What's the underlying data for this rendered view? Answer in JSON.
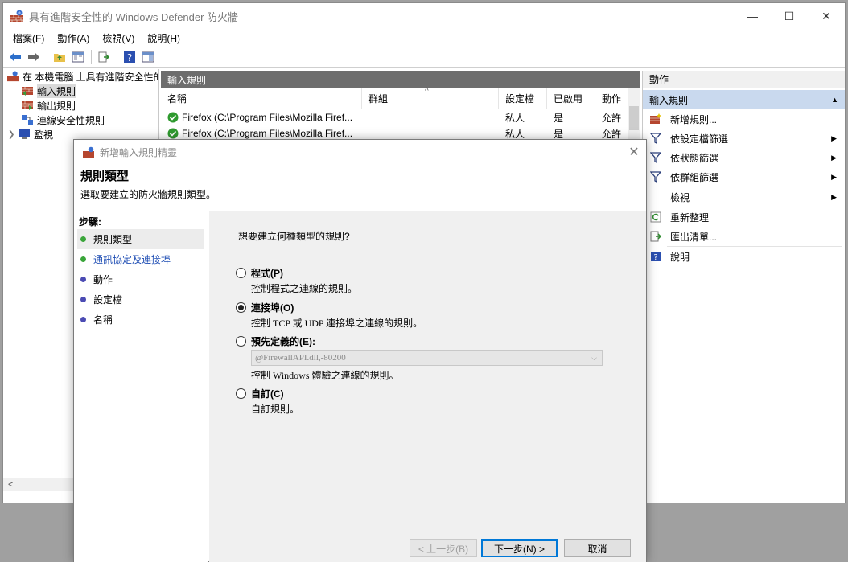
{
  "window": {
    "title": "具有進階安全性的 Windows Defender 防火牆",
    "minimize": "—",
    "maximize": "☐",
    "close": "✕"
  },
  "menu": [
    "檔案(F)",
    "動作(A)",
    "檢視(V)",
    "說明(H)"
  ],
  "tree": {
    "root": "在 本機電腦 上具有進階安全性的",
    "items": [
      {
        "label": "輸入規則",
        "selected": true
      },
      {
        "label": "輸出規則",
        "selected": false
      },
      {
        "label": "連線安全性規則",
        "selected": false
      },
      {
        "label": "監視",
        "selected": false
      }
    ],
    "scroll_left": "<"
  },
  "center": {
    "header": "輸入規則",
    "columns": [
      "名稱",
      "群組",
      "設定檔",
      "已啟用",
      "動作"
    ],
    "rows": [
      {
        "name": "Firefox (C:\\Program Files\\Mozilla Firef...",
        "group": "",
        "profile": "私人",
        "enabled": "是",
        "action": "允許"
      },
      {
        "name": "Firefox (C:\\Program Files\\Mozilla Firef...",
        "group": "",
        "profile": "私人",
        "enabled": "是",
        "action": "允許"
      }
    ]
  },
  "actions": {
    "header": "動作",
    "section": "輸入規則",
    "items": [
      {
        "label": "新增規則...",
        "icon": "new-rule-icon",
        "submenu": false
      },
      {
        "label": "依設定檔篩選",
        "icon": "filter-icon",
        "submenu": true
      },
      {
        "label": "依狀態篩選",
        "icon": "filter-icon",
        "submenu": true
      },
      {
        "label": "依群組篩選",
        "icon": "filter-icon",
        "submenu": true
      },
      {
        "label": "檢視",
        "icon": "",
        "submenu": true
      },
      {
        "label": "重新整理",
        "icon": "refresh-icon",
        "submenu": false
      },
      {
        "label": "匯出清單...",
        "icon": "export-icon",
        "submenu": false
      },
      {
        "label": "說明",
        "icon": "help-icon",
        "submenu": false
      }
    ]
  },
  "wizard": {
    "title": "新增輸入規則精靈",
    "close": "✕",
    "heading": "規則類型",
    "subheading": "選取要建立的防火牆規則類型。",
    "steps_title": "步驟:",
    "steps": [
      {
        "label": "規則類型",
        "current": true,
        "link": false,
        "dot": "#3aa53a"
      },
      {
        "label": "通訊協定及連接埠",
        "current": false,
        "link": true,
        "dot": "#3aa53a"
      },
      {
        "label": "動作",
        "current": false,
        "link": false,
        "dot": "#4b4bb3"
      },
      {
        "label": "設定檔",
        "current": false,
        "link": false,
        "dot": "#4b4bb3"
      },
      {
        "label": "名稱",
        "current": false,
        "link": false,
        "dot": "#4b4bb3"
      }
    ],
    "question": "想要建立何種類型的規則?",
    "options": [
      {
        "label": "程式(P)",
        "desc": "控制程式之連線的規則。",
        "checked": false
      },
      {
        "label": "連接埠(O)",
        "desc": "控制 TCP 或 UDP 連接埠之連線的規則。",
        "checked": true
      },
      {
        "label": "預先定義的(E):",
        "desc": "控制 Windows 體驗之連線的規則。",
        "checked": false
      },
      {
        "label": "自訂(C)",
        "desc": "自訂規則。",
        "checked": false
      }
    ],
    "predefined_value": "@FirewallAPI.dll,-80200",
    "buttons": {
      "back": "< 上一步(B)",
      "next": "下一步(N) >",
      "cancel": "取消"
    }
  }
}
